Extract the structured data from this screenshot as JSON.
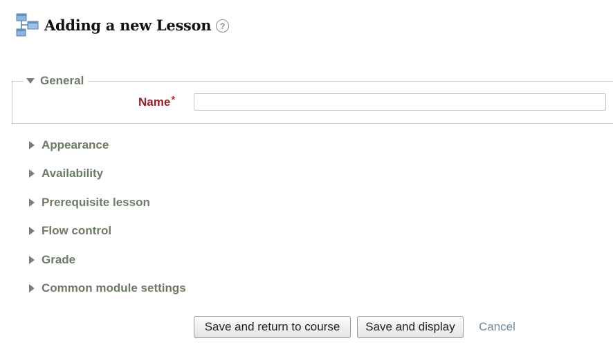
{
  "header": {
    "title": "Adding a new Lesson",
    "help_glyph": "?",
    "icon": "lesson-icon"
  },
  "general": {
    "legend": "General",
    "name_label": "Name",
    "required_mark": "*",
    "name_value": ""
  },
  "sections": [
    {
      "label": "Appearance"
    },
    {
      "label": "Availability"
    },
    {
      "label": "Prerequisite lesson"
    },
    {
      "label": "Flow control"
    },
    {
      "label": "Grade"
    },
    {
      "label": "Common module settings"
    }
  ],
  "buttons": {
    "save_return": "Save and return to course",
    "save_display": "Save and display",
    "cancel": "Cancel"
  },
  "colors": {
    "section_text": "#6c7b66",
    "required_label": "#9b1f23",
    "cancel_link": "#6e8aa3"
  }
}
